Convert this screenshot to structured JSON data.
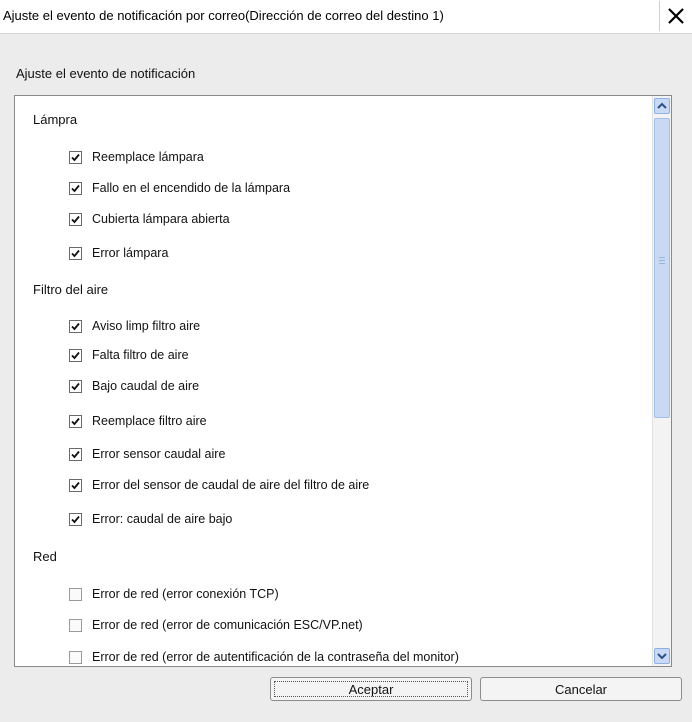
{
  "window": {
    "title": "Ajuste el evento de notificación por correo(Dirección de correo del destino 1)",
    "close_icon": "close-x-icon"
  },
  "dialog": {
    "section_label": "Ajuste el evento de notificación",
    "groups": [
      {
        "label": "Lámpra",
        "items": [
          {
            "label": "Reemplace lámpara",
            "checked": true
          },
          {
            "label": "Fallo en el encendido de la lámpara",
            "checked": true
          },
          {
            "label": "Cubierta lámpara abierta",
            "checked": true
          },
          {
            "label": "Error lámpara",
            "checked": true
          }
        ]
      },
      {
        "label": "Filtro del aire",
        "items": [
          {
            "label": "Aviso limp filtro aire",
            "checked": true
          },
          {
            "label": "Falta filtro de aire",
            "checked": true
          },
          {
            "label": "Bajo caudal de aire",
            "checked": true
          },
          {
            "label": "Reemplace filtro aire",
            "checked": true
          },
          {
            "label": "Error sensor caudal aire",
            "checked": true
          },
          {
            "label": "Error del sensor de caudal de aire del filtro de aire",
            "checked": true
          },
          {
            "label": "Error: caudal de aire bajo",
            "checked": true
          }
        ]
      },
      {
        "label": "Red",
        "items": [
          {
            "label": "Error de red (error conexión TCP)",
            "checked": false
          },
          {
            "label": "Error de red (error de comunicación ESC/VP.net)",
            "checked": false
          },
          {
            "label": "Error de red (error de autentificación de la contraseña del monitor)",
            "checked": false
          }
        ]
      }
    ],
    "scrollbar": {
      "up_icon": "scroll-up-arrow-icon",
      "down_icon": "scroll-down-arrow-icon"
    },
    "buttons": {
      "ok": "Aceptar",
      "cancel": "Cancelar"
    }
  }
}
